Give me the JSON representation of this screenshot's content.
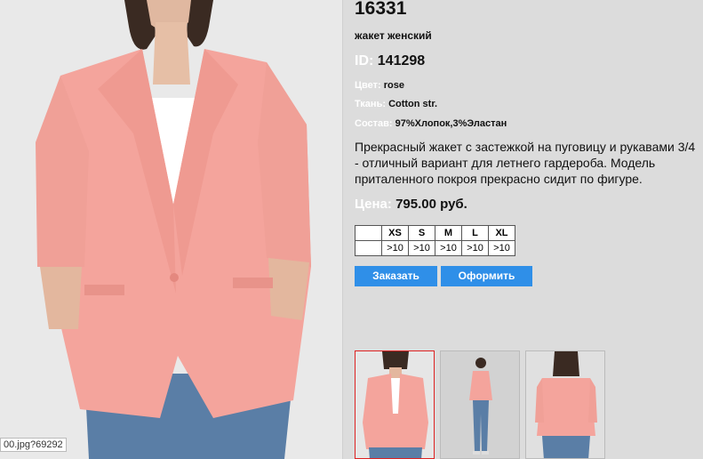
{
  "product": {
    "sku": "16331",
    "name": "жакет женский",
    "id_label": "ID:",
    "id_value": "141298",
    "color_label": "Цвет:",
    "color_value": "rose",
    "fabric_label": "Ткань:",
    "fabric_value": "Cotton str.",
    "composition_label": "Состав:",
    "composition_value": "97%Хлопок,3%Эластан",
    "description": "Прекрасный жакет с застежкой на пуговицу и рукавами 3/4 - отличный вариант для летнего гардероба. Модель приталенного покроя прекрасно сидит по фигуре.",
    "price_label": "Цена:",
    "price_value": "795.00 руб."
  },
  "sizes": {
    "headers": [
      "XS",
      "S",
      "M",
      "L",
      "XL"
    ],
    "stock": [
      ">10",
      ">10",
      ">10",
      ">10",
      ">10"
    ]
  },
  "buttons": {
    "order": "Заказать",
    "checkout": "Оформить"
  },
  "status_bar": {
    "url": "00.jpg?69292"
  },
  "colors": {
    "jacket": "#f4a49c",
    "accent": "#2f8fe8",
    "selected_thumb_border": "#dd2222"
  }
}
